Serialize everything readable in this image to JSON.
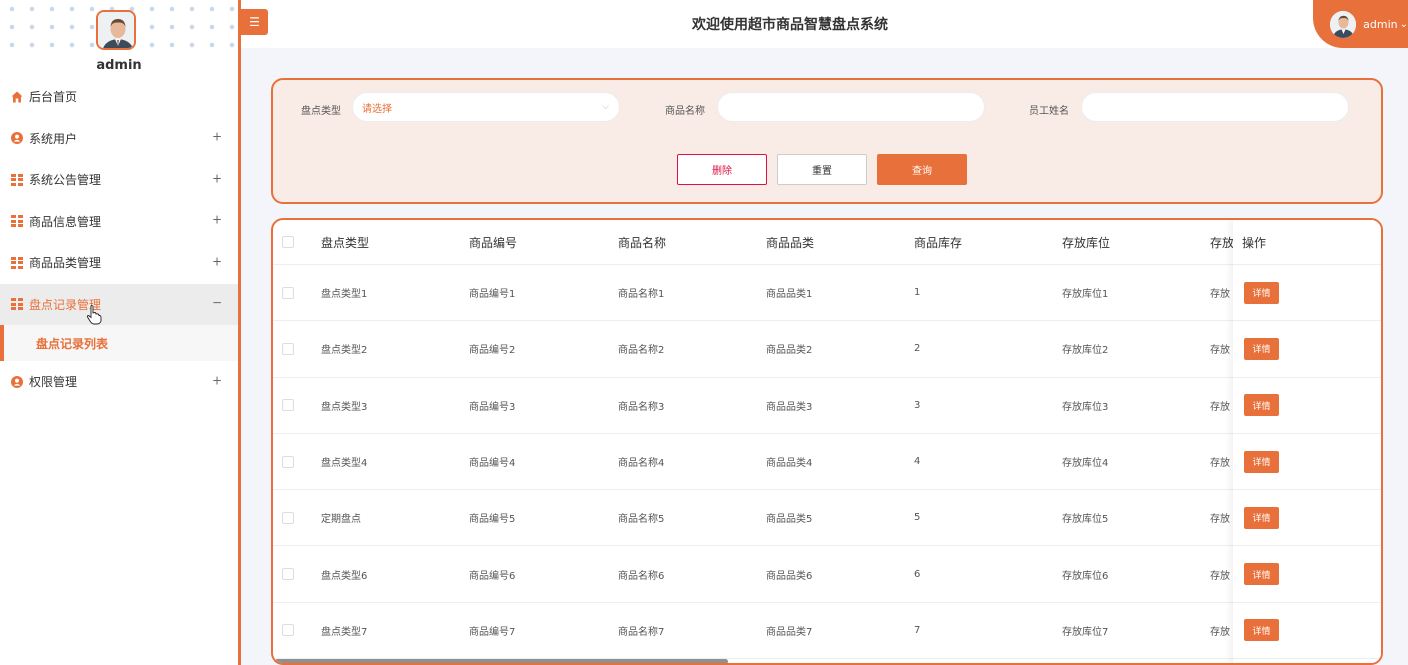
{
  "sidebar": {
    "profile_name": "admin",
    "menu": [
      {
        "label": "后台首页",
        "icon": "home-icon",
        "sign": ""
      },
      {
        "label": "系统用户",
        "icon": "user-icon",
        "sign": "+"
      },
      {
        "label": "系统公告管理",
        "icon": "grid-icon",
        "sign": "+"
      },
      {
        "label": "商品信息管理",
        "icon": "grid-icon",
        "sign": "+"
      },
      {
        "label": "商品品类管理",
        "icon": "grid-icon",
        "sign": "+"
      },
      {
        "label": "盘点记录管理",
        "icon": "grid-icon",
        "sign": "−"
      },
      {
        "label": "盘点记录列表",
        "icon": "",
        "sign": ""
      },
      {
        "label": "权限管理",
        "icon": "user-icon",
        "sign": "+"
      }
    ]
  },
  "header": {
    "menu_toggle": "☰",
    "title": "欢迎使用超市商品智慧盘点系统",
    "user_name": "admin",
    "user_caret": "⌄"
  },
  "search": {
    "type_label": "盘点类型",
    "type_placeholder": "请选择",
    "name_label": "商品名称",
    "name_value": "",
    "staff_label": "员工姓名",
    "staff_value": "",
    "delete_label": "删除",
    "reset_label": "重置",
    "query_label": "查询"
  },
  "table": {
    "columns": [
      "盘点类型",
      "商品编号",
      "商品名称",
      "商品品类",
      "商品库存",
      "存放库位",
      "存放"
    ],
    "op_header": "操作",
    "detail_label": "详情",
    "rows": [
      [
        "盘点类型1",
        "商品编号1",
        "商品名称1",
        "商品品类1",
        "1",
        "存放库位1",
        "存放"
      ],
      [
        "盘点类型2",
        "商品编号2",
        "商品名称2",
        "商品品类2",
        "2",
        "存放库位2",
        "存放"
      ],
      [
        "盘点类型3",
        "商品编号3",
        "商品名称3",
        "商品品类3",
        "3",
        "存放库位3",
        "存放"
      ],
      [
        "盘点类型4",
        "商品编号4",
        "商品名称4",
        "商品品类4",
        "4",
        "存放库位4",
        "存放"
      ],
      [
        "定期盘点",
        "商品编号5",
        "商品名称5",
        "商品品类5",
        "5",
        "存放库位5",
        "存放"
      ],
      [
        "盘点类型6",
        "商品编号6",
        "商品名称6",
        "商品品类6",
        "6",
        "存放库位6",
        "存放"
      ],
      [
        "盘点类型7",
        "商品编号7",
        "商品名称7",
        "商品品类7",
        "7",
        "存放库位7",
        "存放"
      ]
    ]
  },
  "colors": {
    "accent": "#e8703a",
    "danger": "#dd1144",
    "search_bg": "#f9ece7"
  }
}
